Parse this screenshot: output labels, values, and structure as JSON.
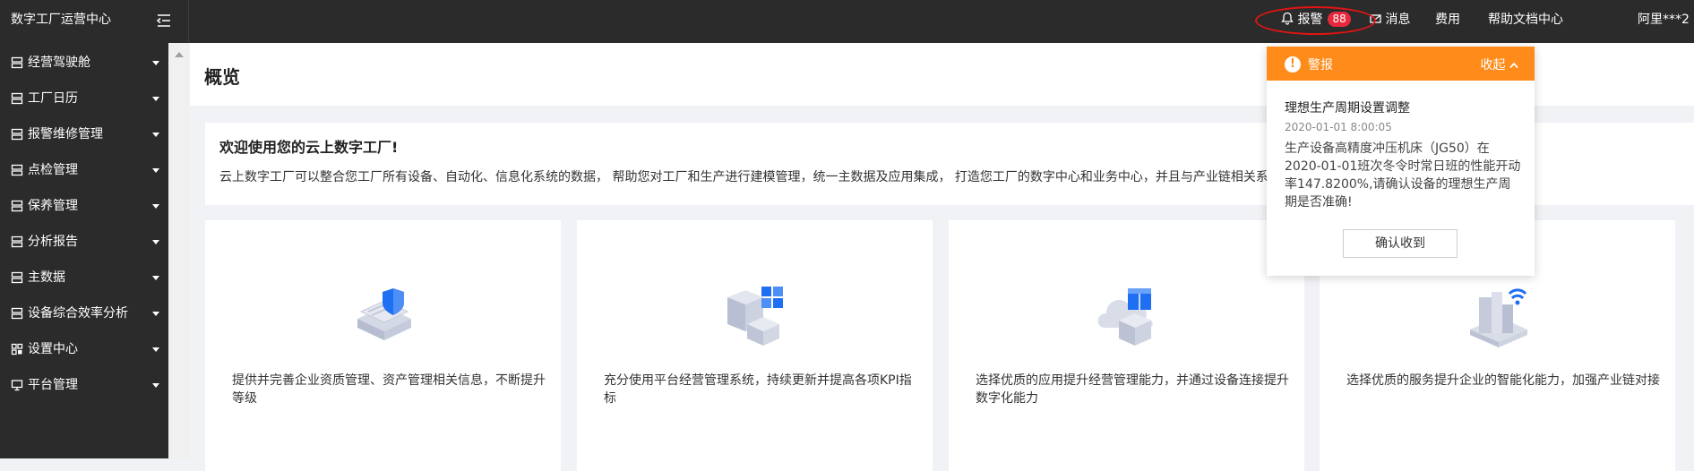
{
  "header": {
    "brand": "数字工厂运营中心",
    "nav": {
      "alarm_label": "报警",
      "alarm_count": "88",
      "messages_label": "消息",
      "fees_label": "费用",
      "help_label": "帮助文档中心",
      "user_label": "阿里***2"
    }
  },
  "sidebar": {
    "items": [
      {
        "label": "经营驾驶舱",
        "icon": "server-icon"
      },
      {
        "label": "工厂日历",
        "icon": "server-icon"
      },
      {
        "label": "报警维修管理",
        "icon": "server-icon"
      },
      {
        "label": "点检管理",
        "icon": "server-icon"
      },
      {
        "label": "保养管理",
        "icon": "server-icon"
      },
      {
        "label": "分析报告",
        "icon": "server-icon"
      },
      {
        "label": "主数据",
        "icon": "server-icon"
      },
      {
        "label": "设备综合效率分析",
        "icon": "server-icon"
      },
      {
        "label": "设置中心",
        "icon": "grid-icon"
      },
      {
        "label": "平台管理",
        "icon": "monitor-icon"
      }
    ]
  },
  "page": {
    "title": "概览",
    "welcome_title": "欢迎使用您的云上数字工厂!",
    "welcome_desc": "云上数字工厂可以整合您工厂所有设备、自动化、信息化系统的数据， 帮助您对工厂和生产进行建模管理，统一主数据及应用集成， 打造您工厂的数字中心和业务中心，并且与产业链相关系统"
  },
  "cards": [
    {
      "desc": "提供并完善企业资质管理、资产管理相关信息，不断提升等级",
      "icon": "shield-document-icon"
    },
    {
      "desc": "充分使用平台经营管理系统，持续更新并提高各项KPI指标",
      "icon": "cube-grid-icon"
    },
    {
      "desc": "选择优质的应用提升经营管理能力，并通过设备连接提升数字化能力",
      "icon": "cloud-box-icon"
    },
    {
      "desc": "选择优质的服务提升企业的智能化能力，加强产业链对接",
      "icon": "building-wifi-icon"
    }
  ],
  "alarm_popup": {
    "title": "警报",
    "collapse_label": "收起",
    "message_title": "理想生产周期设置调整",
    "time": "2020-01-01 8:00:05",
    "body": "生产设备高精度冲压机床（JG50）在2020-01-01班次冬令时常日班的性能开动率147.8200%,请确认设备的理想生产周期是否准确!",
    "confirm_label": "确认收到"
  },
  "colors": {
    "topbar_bg": "#2b2b2b",
    "accent_orange": "#ff8c1a",
    "badge_red": "#e8283c",
    "annotation_red": "#e11414"
  }
}
